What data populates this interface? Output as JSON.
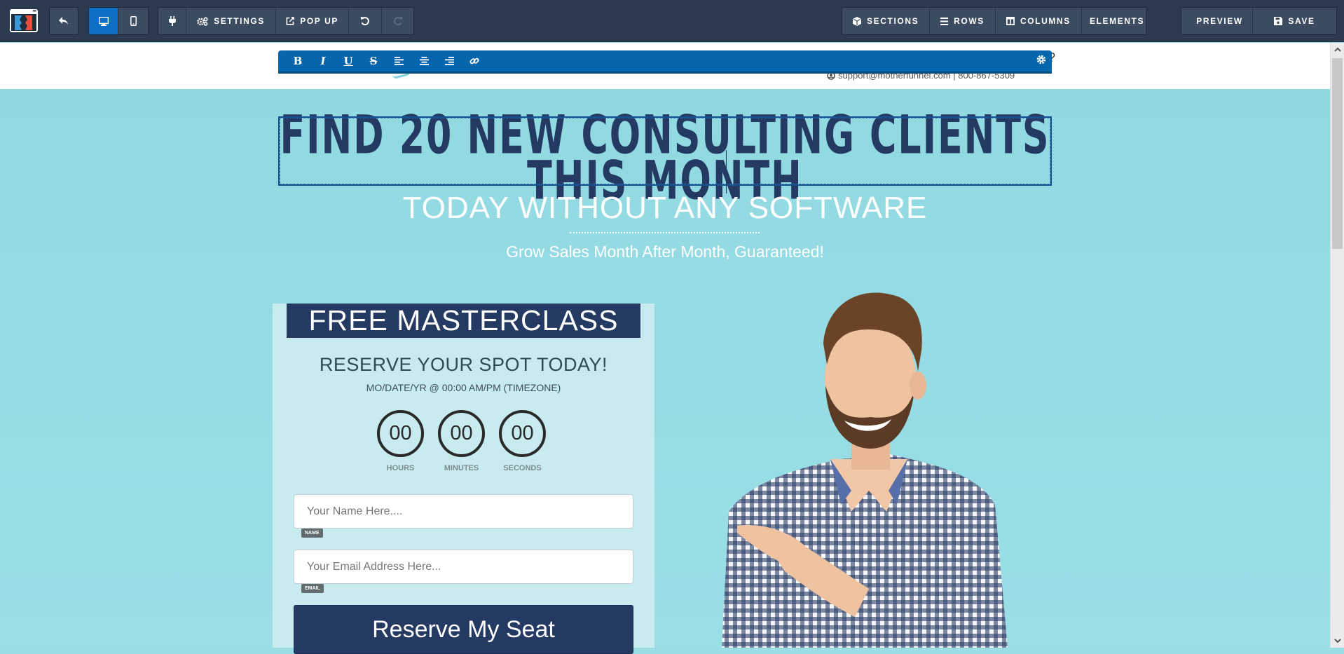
{
  "toolbar": {
    "logo_icon": "clickfunnels-logo",
    "undo_nav_icon": "reply-arrow-icon",
    "device_modes": [
      {
        "name": "desktop",
        "icon": "desktop-icon",
        "active": true
      },
      {
        "name": "mobile",
        "icon": "mobile-icon",
        "active": false
      }
    ],
    "plugin_icon": "plug-icon",
    "settings_label": "SETTINGS",
    "popup_label": "POP UP",
    "undo_icon": "undo-icon",
    "redo_icon": "redo-icon",
    "redo_disabled": true,
    "sections_label": "SECTIONS",
    "rows_label": "ROWS",
    "columns_label": "COLUMNS",
    "elements_label": "ELEMENTS",
    "preview_label": "PREVIEW",
    "save_label": "SAVE",
    "active_color": "#0e6fc4",
    "bar_color": "#2b3a4e"
  },
  "text_toolbar": {
    "buttons": [
      "B",
      "I",
      "U",
      "S",
      "align-left",
      "align-center",
      "align-right",
      "link"
    ],
    "color": "#0565ad"
  },
  "page_header": {
    "question_mark": "?",
    "contact": "support@motherfunnel.com | 800-867-5309"
  },
  "hero": {
    "headline": "FIND 20 NEW CONSULTING CLIENTS THIS MONTH",
    "subheadline": "TODAY WITHOUT ANY SOFTWARE",
    "tagline": "Grow Sales Month After Month, Guaranteed!",
    "background_color": "#9adde5",
    "headline_color": "#243a63"
  },
  "form_panel": {
    "banner": "FREE MASTERCLASS",
    "title": "RESERVE YOUR SPOT TODAY!",
    "date": "MO/DATE/YR @ 00:00 AM/PM (TIMEZONE)",
    "countdown": [
      {
        "value": "00",
        "label": "HOURS"
      },
      {
        "value": "00",
        "label": "MINUTES"
      },
      {
        "value": "00",
        "label": "SECONDS"
      }
    ],
    "name_field": {
      "placeholder": "Your Name Here....",
      "tag": "NAME"
    },
    "email_field": {
      "placeholder": "Your Email Address Here...",
      "tag": "EMAIL"
    },
    "cta_label": "Reserve My Seat",
    "cta_color": "#243a63"
  },
  "image": {
    "alt": "Smiling bearded man in checkered shirt pointing left"
  }
}
